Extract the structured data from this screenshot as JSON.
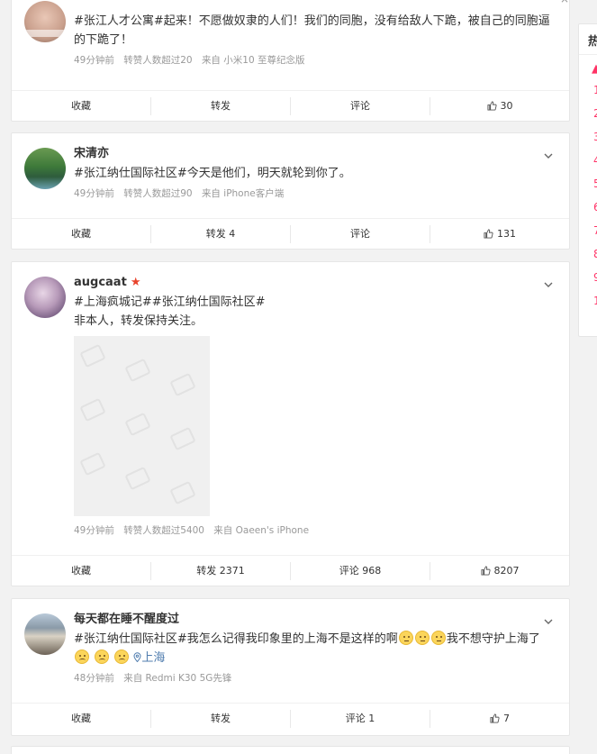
{
  "posts": [
    {
      "username": "",
      "avatar_text": "",
      "text_parts": [
        "#张江人才公寓#",
        "起来！不愿做奴隶的人们！我们的同胞，没有给敌人下跪，被自己的同胞逼的下跪了！"
      ],
      "meta": [
        "49分钟前",
        "转赞人数超过20",
        "来自 小米10 至尊纪念版"
      ],
      "actions": {
        "collect": "收藏",
        "repost": "转发",
        "comment": "评论",
        "like": "30"
      }
    },
    {
      "username": "宋清亦",
      "text_parts": [
        "#张江纳仕国际社区#",
        "今天是他们，明天就轮到你了。"
      ],
      "meta": [
        "49分钟前",
        "转赞人数超过90",
        "来自 iPhone客户端"
      ],
      "actions": {
        "collect": "收藏",
        "repost": "转发 4",
        "comment": "评论",
        "like": "131"
      }
    },
    {
      "username": "augcaat",
      "text_parts": [
        "#上海疯城记##张江纳仕国际社区#",
        "非本人，转发保持关注。"
      ],
      "meta": [
        "49分钟前",
        "转赞人数超过5400",
        "来自 Oaeen's iPhone"
      ],
      "actions": {
        "collect": "收藏",
        "repost": "转发 2371",
        "comment": "评论 968",
        "like": "8207"
      }
    },
    {
      "username": "每天都在睡不醒度过",
      "text_parts": [
        "#张江纳仕国际社区#",
        "我怎么记得我印象里的上海不是这样的啊",
        "我不想守护上海了",
        "上海"
      ],
      "meta": [
        "48分钟前",
        "来自 Redmi K30 5G先锋"
      ],
      "actions": {
        "collect": "收藏",
        "repost": "转发",
        "comment": "评论 1",
        "like": "7"
      }
    }
  ],
  "sidebar": {
    "title": "热",
    "ranks": [
      "1",
      "2",
      "3",
      "4",
      "5",
      "6",
      "7",
      "8",
      "9",
      "1"
    ]
  },
  "colors": {
    "accent": "#e8432c",
    "link": "#507daf",
    "background": "#f2f2f2"
  }
}
